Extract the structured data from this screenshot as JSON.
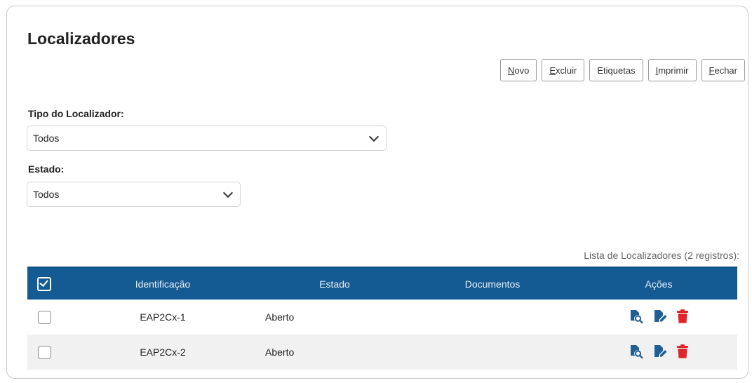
{
  "page": {
    "title": "Localizadores"
  },
  "toolbar": {
    "buttons": [
      {
        "pre": "",
        "u": "N",
        "post": "ovo"
      },
      {
        "pre": "",
        "u": "E",
        "post": "xcluir"
      },
      {
        "pre": "Etiquetas",
        "u": "",
        "post": ""
      },
      {
        "pre": "",
        "u": "I",
        "post": "mprimir"
      },
      {
        "pre": "",
        "u": "F",
        "post": "echar"
      }
    ]
  },
  "filters": {
    "tipo": {
      "label": "Tipo do Localizador:",
      "value": "Todos"
    },
    "estado": {
      "label": "Estado:",
      "value": "Todos"
    }
  },
  "list": {
    "caption": "Lista de Localizadores (2 registros):",
    "columns": [
      "Identificação",
      "Estado",
      "Documentos",
      "Ações"
    ],
    "rows": [
      {
        "id": "EAP2Cx-1",
        "estado": "Aberto",
        "documentos": ""
      },
      {
        "id": "EAP2Cx-2",
        "estado": "Aberto",
        "documentos": ""
      }
    ],
    "icons": {
      "view": "search-document-icon",
      "edit": "edit-document-icon",
      "delete": "trash-icon"
    },
    "colors": {
      "header_bg": "#155b93",
      "icon_blue": "#1f5f93",
      "icon_red": "#e0252d"
    }
  }
}
